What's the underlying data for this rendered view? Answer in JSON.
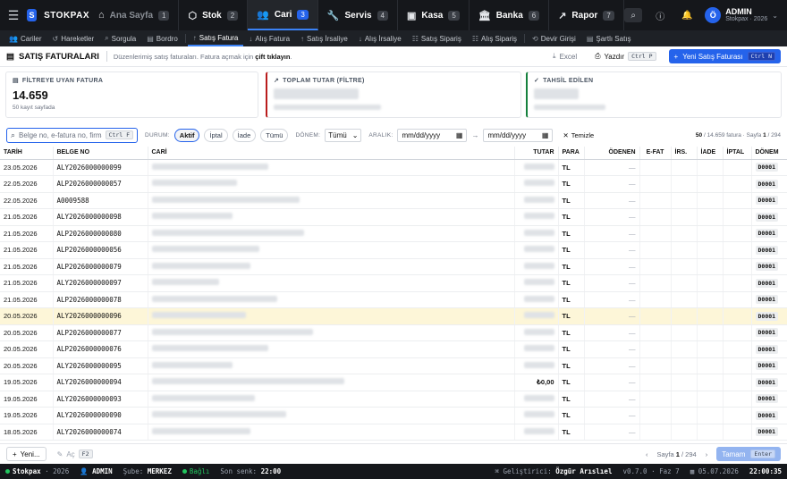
{
  "app": {
    "logo_letter": "S",
    "name": "STOKPAX"
  },
  "topnav": {
    "tabs": [
      {
        "label": "Ana Sayfa",
        "badge": "1",
        "icon": "home-icon"
      },
      {
        "label": "Stok",
        "badge": "2",
        "icon": "box-icon"
      },
      {
        "label": "Cari",
        "badge": "3",
        "icon": "users-icon"
      },
      {
        "label": "Servis",
        "badge": "4",
        "icon": "wrench-icon"
      },
      {
        "label": "Kasa",
        "badge": "5",
        "icon": "cash-icon"
      },
      {
        "label": "Banka",
        "badge": "6",
        "icon": "bank-icon"
      },
      {
        "label": "Rapor",
        "badge": "7",
        "icon": "trend-icon"
      }
    ],
    "active_tab": "Cari",
    "user": {
      "avatar_letter": "Ö",
      "name": "ADMIN",
      "sub": "Stokpax · 2026"
    }
  },
  "subnav": {
    "items": [
      {
        "label": "Cariler",
        "icon": "users-icon"
      },
      {
        "label": "Hareketler",
        "icon": "history-icon"
      },
      {
        "label": "Sorgula",
        "icon": "search-icon"
      },
      {
        "label": "Bordro",
        "icon": "document-icon"
      },
      {
        "label": "Satış Fatura",
        "icon": "arrow-up-icon"
      },
      {
        "label": "Alış Fatura",
        "icon": "arrow-down-icon"
      },
      {
        "label": "Satış İrsaliye",
        "icon": "arrow-up-icon"
      },
      {
        "label": "Alış İrsaliye",
        "icon": "arrow-down-icon"
      },
      {
        "label": "Satış Sipariş",
        "icon": "list-icon"
      },
      {
        "label": "Alış Sipariş",
        "icon": "list-icon"
      },
      {
        "label": "Devir Girişi",
        "icon": "rotate-icon"
      },
      {
        "label": "Şartlı Satış",
        "icon": "document-icon"
      }
    ],
    "active": "Satış Fatura"
  },
  "page": {
    "title": "SATIŞ FATURALARI",
    "hint_pre": "Düzenlerimiş satış faturaları. Fatura açmak için",
    "hint_bold": "çift tıklayın",
    "hint_post": ".",
    "excel_label": "Excel",
    "print_label": "Yazdır",
    "print_kbd": "Ctrl P",
    "new_label": "Yeni Satış Faturası",
    "new_kbd": "Ctrl N"
  },
  "cards": {
    "count": {
      "label": "FİLTREYE UYAN FATURA",
      "value": "14.659",
      "sub": "50 kayıt sayfada"
    },
    "total": {
      "label": "TOPLAM TUTAR (FİLTRE)"
    },
    "collected": {
      "label": "TAHSİL EDİLEN"
    }
  },
  "filters": {
    "search_placeholder": "Belge no, e-fatura no, firma...",
    "search_kbd": "Ctrl F",
    "status_label": "DURUM:",
    "status_options": [
      "Aktif",
      "İptal",
      "İade",
      "Tümü"
    ],
    "status_active": "Aktif",
    "period_label": "DÖNEM:",
    "period_value": "Tümü",
    "range_label": "ARALIK:",
    "date_from": "mm/dd/yyyy",
    "date_to": "mm/dd/yyyy",
    "range_arrow": "→",
    "clear_label": "Temizle",
    "page_shown": "50",
    "page_total_text": "/ 14.659 fatura · Sayfa",
    "page_current": "1",
    "page_of": "/ 294"
  },
  "table": {
    "headers": [
      "TARİH",
      "BELGE NO",
      "CARİ",
      "TUTAR",
      "PARA",
      "ÖDENEN",
      "E-FAT",
      "İRS.",
      "İADE",
      "İPTAL",
      "DÖNEM"
    ],
    "rows": [
      {
        "date": "23.05.2026",
        "doc": "ALY2026000000099",
        "amount": "",
        "cur": "TL",
        "paid": "—",
        "period": "D0001"
      },
      {
        "date": "22.05.2026",
        "doc": "ALP2026000000057",
        "amount": "",
        "cur": "TL",
        "paid": "—",
        "period": "D0001"
      },
      {
        "date": "22.05.2026",
        "doc": "A0009588",
        "amount": "",
        "cur": "TL",
        "paid": "—",
        "period": "D0001"
      },
      {
        "date": "21.05.2026",
        "doc": "ALY2026000000098",
        "amount": "",
        "cur": "TL",
        "paid": "—",
        "period": "D0001"
      },
      {
        "date": "21.05.2026",
        "doc": "ALP2026000000080",
        "amount": "",
        "cur": "TL",
        "paid": "—",
        "period": "D0001"
      },
      {
        "date": "21.05.2026",
        "doc": "ALP2026000000056",
        "amount": "",
        "cur": "TL",
        "paid": "—",
        "period": "D0001"
      },
      {
        "date": "21.05.2026",
        "doc": "ALP2026000000079",
        "amount": "",
        "cur": "TL",
        "paid": "—",
        "period": "D0001"
      },
      {
        "date": "21.05.2026",
        "doc": "ALY2026000000097",
        "amount": "",
        "cur": "TL",
        "paid": "—",
        "period": "D0001"
      },
      {
        "date": "21.05.2026",
        "doc": "ALP2026000000078",
        "amount": "",
        "cur": "TL",
        "paid": "—",
        "period": "D0001"
      },
      {
        "date": "20.05.2026",
        "doc": "ALY2026000000096",
        "amount": "",
        "cur": "TL",
        "paid": "—",
        "period": "D0001"
      },
      {
        "date": "20.05.2026",
        "doc": "ALP2026000000077",
        "amount": "",
        "cur": "TL",
        "paid": "—",
        "period": "D0001"
      },
      {
        "date": "20.05.2026",
        "doc": "ALP2026000000076",
        "amount": "",
        "cur": "TL",
        "paid": "—",
        "period": "D0001"
      },
      {
        "date": "20.05.2026",
        "doc": "ALY2026000000095",
        "amount": "",
        "cur": "TL",
        "paid": "—",
        "period": "D0001"
      },
      {
        "date": "19.05.2026",
        "doc": "ALY2026000000094",
        "amount": "₺0,00",
        "cur": "TL",
        "paid": "—",
        "period": "D0001"
      },
      {
        "date": "19.05.2026",
        "doc": "ALY2026000000093",
        "amount": "",
        "cur": "TL",
        "paid": "—",
        "period": "D0001"
      },
      {
        "date": "19.05.2026",
        "doc": "ALY2026000000090",
        "amount": "",
        "cur": "TL",
        "paid": "—",
        "period": "D0001"
      },
      {
        "date": "18.05.2026",
        "doc": "ALY2026000000074",
        "amount": "",
        "cur": "TL",
        "paid": "—",
        "period": "D0001"
      }
    ],
    "highlight_index": 9
  },
  "footer": {
    "new_label": "Yeni...",
    "open_label": "Aç",
    "open_kbd": "F2",
    "pager_text": "Sayfa",
    "pager_current": "1",
    "pager_total": "/ 294",
    "ok_label": "Tamam",
    "ok_kbd": "Enter"
  },
  "statusbar": {
    "app": "Stokpax",
    "year": "· 2026",
    "user": "ADMIN",
    "branch_label": "Şube:",
    "branch": "MERKEZ",
    "conn": "Bağlı",
    "sync_label": "Son senk:",
    "sync_time": "22:00",
    "dev_label": "Geliştirici:",
    "dev": "Özgür Arıslıel",
    "version": "v0.7.0 · Faz 7",
    "date": "05.07.2026",
    "clock": "22:00:35"
  },
  "colors": {
    "accent": "#2563eb",
    "nav_bg": "#15171b",
    "highlight_row": "#fdf6d8"
  }
}
